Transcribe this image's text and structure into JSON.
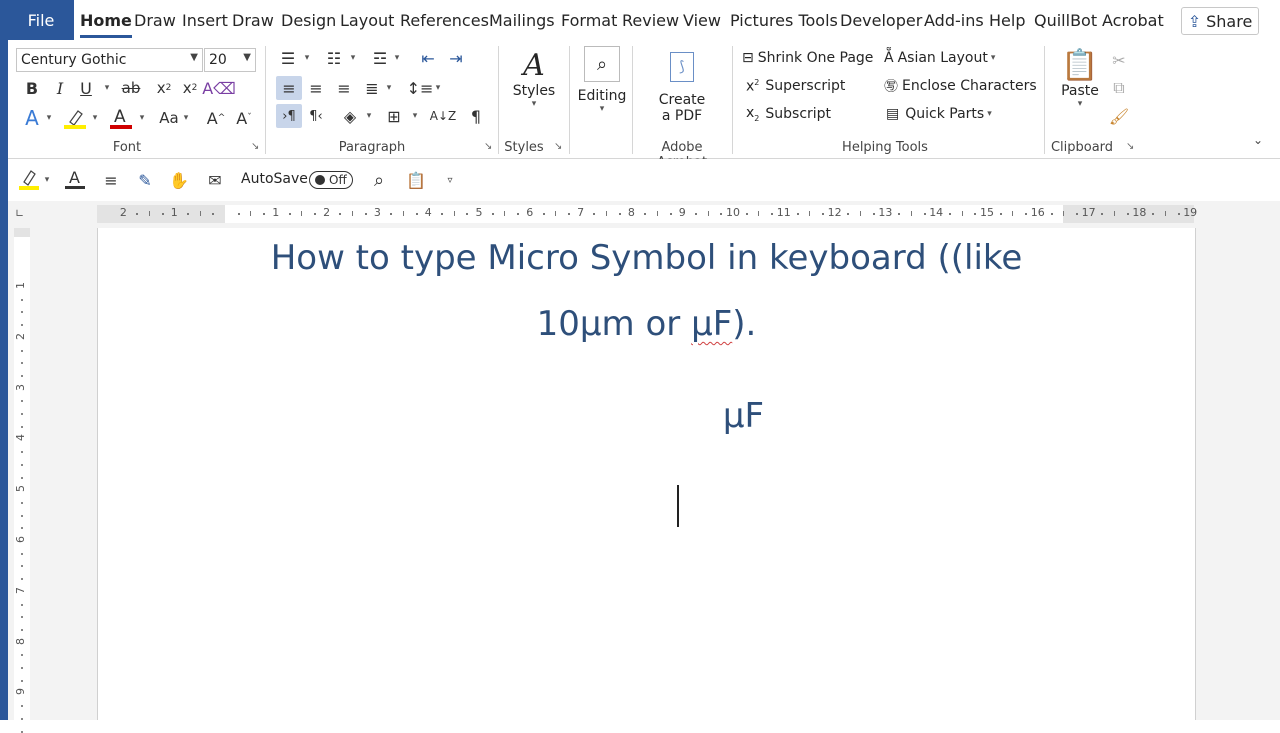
{
  "menu": {
    "file": "File",
    "tabs": [
      "Home",
      "Draw",
      "Insert",
      "Draw",
      "Design",
      "Layout",
      "References",
      "Mailings",
      "Format",
      "Review",
      "View",
      "Pictures Tools",
      "Developer",
      "Add-ins",
      "Help",
      "QuillBot",
      "Acrobat"
    ],
    "active_tab": "Home",
    "share": "Share"
  },
  "font_group": {
    "font_name": "Century Gothic",
    "font_size": "20",
    "label": "Font"
  },
  "paragraph_group": {
    "label": "Paragraph"
  },
  "styles_group": {
    "button": "Styles",
    "label": "Styles"
  },
  "editing": {
    "button": "Editing"
  },
  "acrobat_group": {
    "line1": "Create",
    "line2": "a PDF",
    "label": "Adobe Acrobat"
  },
  "helping_tools": {
    "label": "Helping Tools",
    "shrink": "Shrink One Page",
    "superscript": "Superscript",
    "subscript": "Subscript",
    "asian_layout": "Asian Layout",
    "enclose": "Enclose Characters",
    "quick_parts": "Quick Parts"
  },
  "clipboard": {
    "paste": "Paste",
    "label": "Clipboard"
  },
  "qat": {
    "autosave_label": "AutoSave",
    "autosave_state": "Off"
  },
  "ruler": {
    "horizontal": [
      "2",
      "1",
      "1",
      "2",
      "3",
      "4",
      "5",
      "6",
      "7",
      "8",
      "9",
      "10",
      "11",
      "12",
      "13",
      "14",
      "15",
      "16",
      "17",
      "18",
      "19"
    ],
    "vertical": [
      "1",
      "2",
      "3",
      "4",
      "5",
      "6",
      "7",
      "8",
      "9"
    ]
  },
  "document": {
    "title_line1": "How to type Micro Symbol in keyboard ((like",
    "title_line2_a": "10µm or ",
    "title_line2_b": "µF",
    "title_line2_c": ").",
    "symbol": "µF"
  },
  "colors": {
    "word_blue": "#2b579a",
    "doc_text": "#2e4f7a",
    "ruler_margin": "#e3e3e3"
  }
}
